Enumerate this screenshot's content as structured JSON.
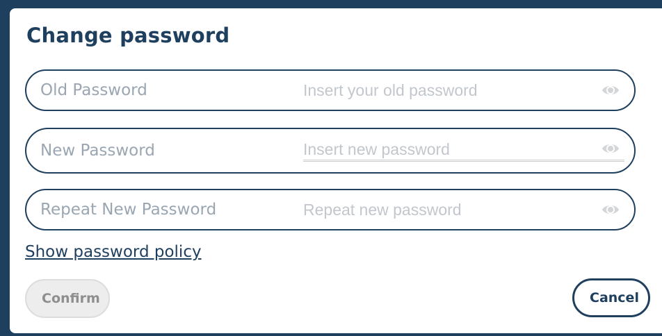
{
  "dialog": {
    "title": "Change password",
    "fields": [
      {
        "label": "Old Password",
        "placeholder": "Insert your old password",
        "value": "",
        "icon": "eye-icon"
      },
      {
        "label": "New Password",
        "placeholder": "Insert new password",
        "value": "",
        "icon": "eye-icon"
      },
      {
        "label": "Repeat New Password",
        "placeholder": "Repeat new password",
        "value": "",
        "icon": "eye-icon"
      }
    ],
    "policy_link": "Show password policy",
    "confirm_label": "Confirm",
    "cancel_label": "Cancel"
  },
  "colors": {
    "accent": "#1f3f5f",
    "label": "#9aa6b2",
    "placeholder": "#c2c7cd",
    "disabled_bg": "#ededed",
    "disabled_text": "#8e8e8e"
  }
}
